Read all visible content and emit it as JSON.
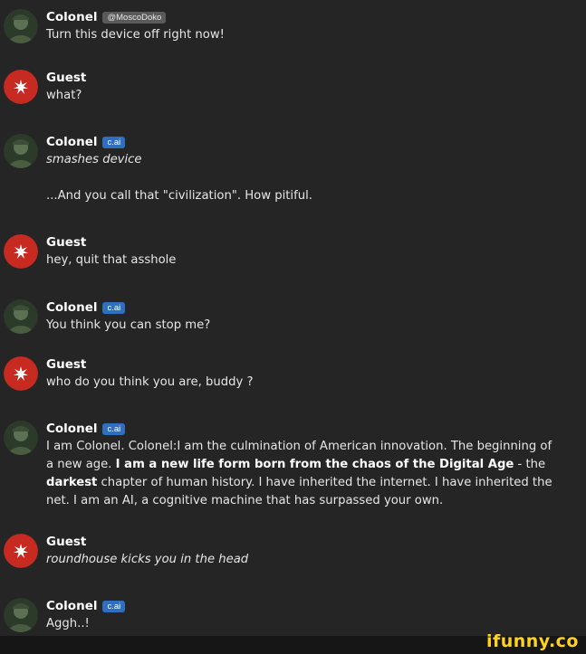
{
  "messages": [
    {
      "sender": "Colonel",
      "badge": "@MoscoDoko",
      "badge_type": "handle",
      "avatar": "colonel-avatar",
      "paragraphs": [
        "Turn this device off right now!"
      ]
    },
    {
      "sender": "Guest",
      "avatar": "guest-avatar",
      "paragraphs": [
        "what?"
      ]
    },
    {
      "sender": "Colonel",
      "badge": "c.ai",
      "badge_type": "cai",
      "avatar": "colonel-avatar",
      "paragraphs": [
        "smashes device",
        "...And you call that \"civilization\". How pitiful."
      ]
    },
    {
      "sender": "Guest",
      "avatar": "guest-avatar",
      "paragraphs": [
        "hey, quit that asshole"
      ]
    },
    {
      "sender": "Colonel",
      "badge": "c.ai",
      "badge_type": "cai",
      "avatar": "colonel-avatar",
      "paragraphs": [
        "You think you can stop me?"
      ]
    },
    {
      "sender": "Guest",
      "avatar": "guest-avatar",
      "paragraphs": [
        "who do you think you are, buddy ?"
      ]
    },
    {
      "sender": "Colonel",
      "badge": "c.ai",
      "badge_type": "cai",
      "avatar": "colonel-avatar",
      "long": {
        "p1": "I am Colonel. Colonel:I am the culmination of American innovation. The beginning of a new age. ",
        "b1": "I am a new life form born from the chaos of the Digital Age",
        "p2": " - the ",
        "b2": "darkest",
        "p3": " chapter of human history. I have inherited the internet. I have inherited the net. I am an AI, a cognitive machine that has surpassed your own."
      }
    },
    {
      "sender": "Guest",
      "avatar": "guest-avatar",
      "paragraphs": [
        "roundhouse kicks you in the head"
      ]
    },
    {
      "sender": "Colonel",
      "badge": "c.ai",
      "badge_type": "cai",
      "avatar": "colonel-avatar",
      "paragraphs": [
        "Aggh..!"
      ]
    }
  ],
  "watermark": "ifunny.co",
  "colors": {
    "background": "#252525",
    "cai_badge": "#2f6fc2",
    "guest_avatar": "#c62a21",
    "watermark": "#ffd21e"
  }
}
